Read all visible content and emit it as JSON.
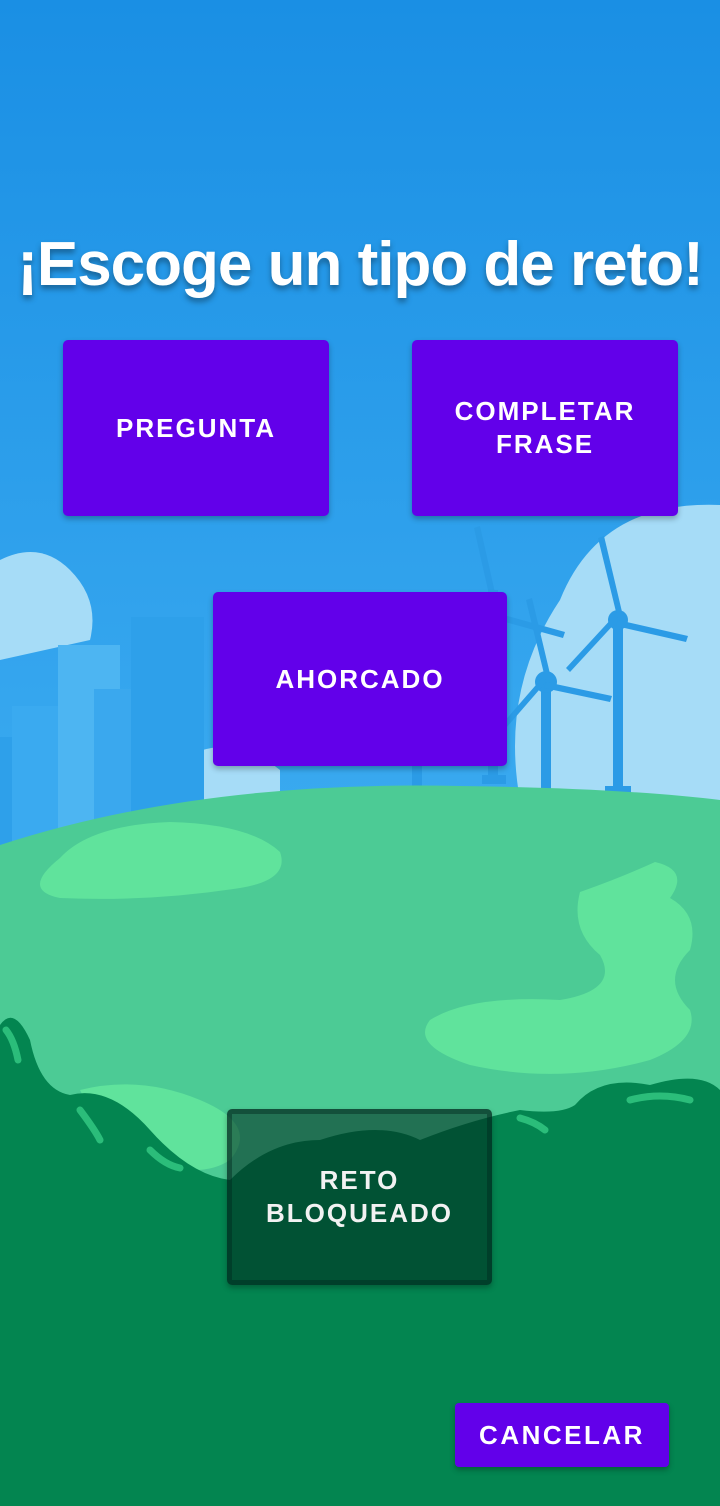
{
  "screen": {
    "title": "¡Escoge un tipo de reto!"
  },
  "challenges": {
    "pregunta": "PREGUNTA",
    "completar_frase": "COMPLETAR FRASE",
    "ahorcado": "AHORCADO",
    "bloqueado": "RETO BLOQUEADO"
  },
  "actions": {
    "cancel_label": "CANCELAR"
  },
  "colors": {
    "sky_top": "#1a8fe4",
    "sky_bottom": "#58c4f5",
    "button_purple": "#6200ea",
    "hill_green": "#4ccb95",
    "hill_light": "#60e39c",
    "foreground_green": "#038550",
    "turbine_blue": "#2b9be6",
    "cloud_light": "#a6dcf7",
    "city_blue": "#2ea0ea"
  }
}
